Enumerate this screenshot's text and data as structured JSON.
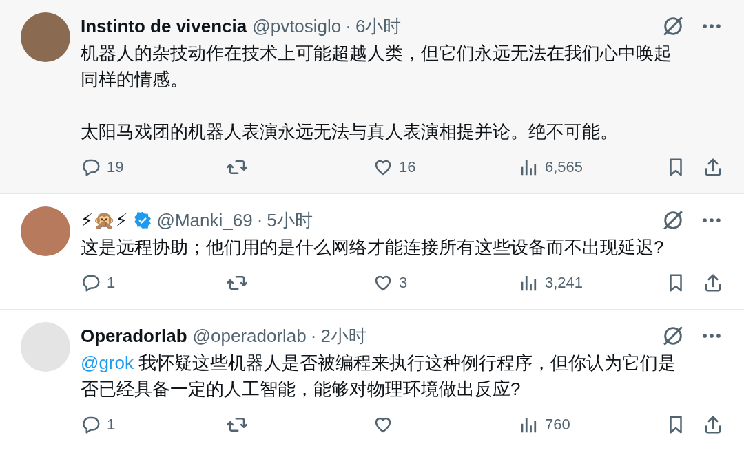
{
  "posts": [
    {
      "highlighted": true,
      "display_name": "Instinto de vivencia",
      "verified": false,
      "handle": "@pvtosiglo",
      "separator": "·",
      "time": "6小时",
      "paragraphs": [
        [
          {
            "kind": "text",
            "text": "机器人的杂技动作在技术上可能超越人类，但它们永远无法在我们心中唤起同样的情感。"
          }
        ],
        [
          {
            "kind": "text",
            "text": "太阳马戏团的机器人表演永远无法与真人表演相提并论。绝不可能。"
          }
        ]
      ],
      "replies": "19",
      "likes": "16",
      "views": "6,565"
    },
    {
      "highlighted": false,
      "display_name": "⚡🙊⚡",
      "verified": true,
      "handle": "@Manki_69",
      "separator": "·",
      "time": "5小时",
      "paragraphs": [
        [
          {
            "kind": "text",
            "text": "这是远程协助；他们用的是什么网络才能连接所有这些设备而不出现延迟?"
          }
        ]
      ],
      "replies": "1",
      "likes": "3",
      "views": "3,241"
    },
    {
      "highlighted": false,
      "display_name": "Operadorlab",
      "verified": false,
      "handle": "@operadorlab",
      "separator": "·",
      "time": "2小时",
      "paragraphs": [
        [
          {
            "kind": "mention",
            "text": "@grok"
          },
          {
            "kind": "text",
            "text": " 我怀疑这些机器人是否被编程来执行这种例行程序，但你认为它们是否已经具备一定的人工智能，能够对物理环境做出反应?"
          }
        ]
      ],
      "replies": "1",
      "views": "760"
    }
  ]
}
